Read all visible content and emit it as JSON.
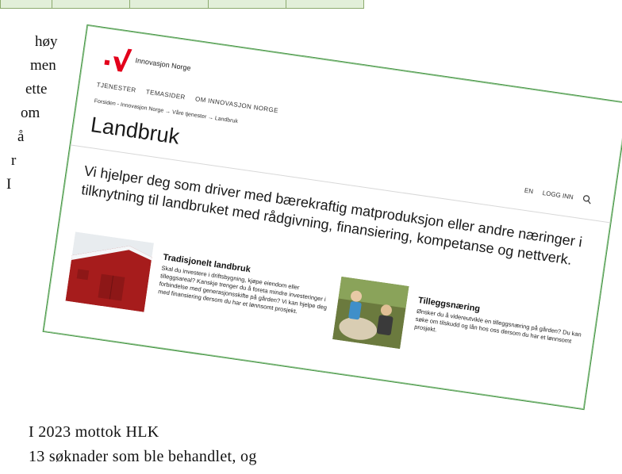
{
  "body_fragments": [
    "høy",
    "men",
    "ette",
    "om",
    "å",
    "r",
    "I"
  ],
  "bottom_text": {
    "line1": "I 2023 mottok HLK",
    "line2": "13 søknader som ble behandlet, og"
  },
  "site": {
    "logo_text": "Innovasjon Norge",
    "nav": [
      "TJENESTER",
      "TEMASIDER",
      "OM INNOVASJON NORGE"
    ],
    "breadcrumb": "Forsiden - Innovasjon Norge → Våre tjenester → Landbruk",
    "page_title": "Landbruk",
    "utils": {
      "lang": "EN",
      "login": "LOGG INN"
    },
    "lead": "Vi hjelper deg som driver med bærekraftig matproduksjon eller andre næringer i tilknytning til landbruket med rådgivning, finansiering, kompetanse og nettverk.",
    "items": [
      {
        "title": "Tradisjonelt landbruk",
        "text": "Skal du investere i driftsbygning, kjøpe eiendom eller tilleggsareal? Kanskje trenger du å foreta mindre investeringer i forbindelse med generasjonsskifte på gården? Vi kan hjelpe deg med finansiering dersom du har et lønnsomt prosjekt."
      },
      {
        "title": "Tilleggsnæring",
        "text": "Ønsker du å videreutvikle en tilleggsnæring på gården? Du kan søke om tilskudd og lån hos oss dersom du har et lønnsomt prosjekt."
      }
    ]
  },
  "colors": {
    "brand_red": "#e3001b",
    "card_border": "#3c8f3a",
    "table_fill": "#e2efd9"
  }
}
